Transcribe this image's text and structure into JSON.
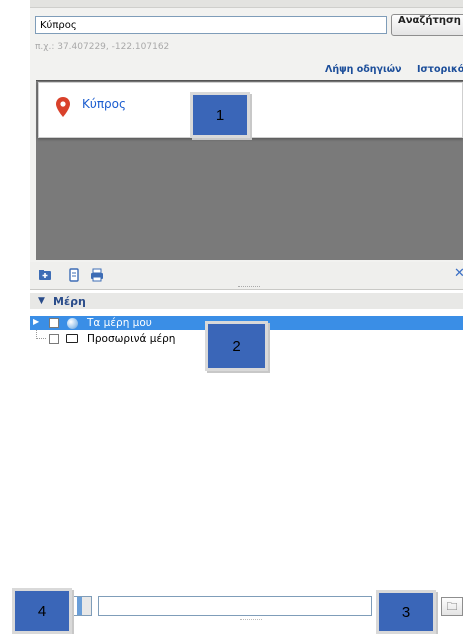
{
  "search": {
    "value": "Κύπρος",
    "button_label": "Αναζήτηση",
    "coord_hint": "π.χ.: 37.407229, -122.107162",
    "directions_link": "Λήψη οδηγιών",
    "history_link": "Ιστορικό"
  },
  "results": [
    {
      "label": "Κύπρος",
      "icon": "map-pin-icon",
      "icon_color": "#d9412b"
    }
  ],
  "toolbar": {
    "icons": [
      "add-to-places-icon",
      "copy-icon",
      "print-icon",
      "close-icon"
    ],
    "close_symbol": "✕"
  },
  "places": {
    "title": "Μέρη",
    "items": [
      {
        "label": "Τα μέρη μου",
        "icon": "globe-icon",
        "selected": true
      },
      {
        "label": "Προσωρινά μέρη",
        "icon": "folder-icon",
        "selected": false
      }
    ]
  },
  "callouts": [
    "1",
    "2",
    "3",
    "4"
  ],
  "colors": {
    "selection": "#3a8ee6",
    "link": "#1c4e9a",
    "callout": "#3a66b8",
    "results_background": "#7a7a7a"
  }
}
